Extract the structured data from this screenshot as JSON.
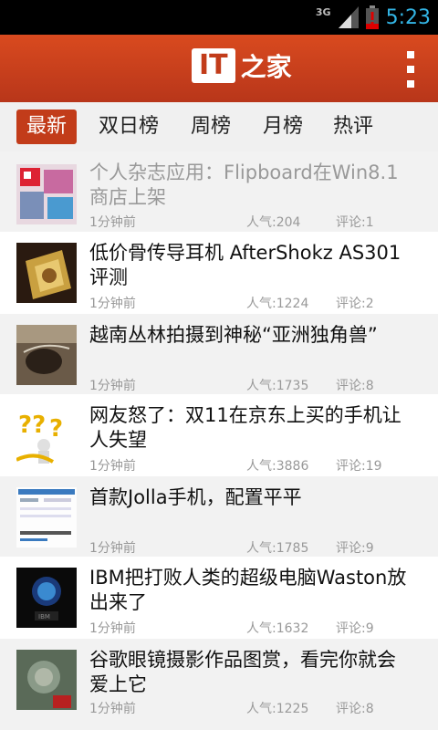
{
  "status": {
    "network": "3G",
    "time": "5:23"
  },
  "app": {
    "logo_it": "IT",
    "logo_text": "之家"
  },
  "tabs": [
    {
      "label": "最新",
      "active": true
    },
    {
      "label": "双日榜",
      "active": false
    },
    {
      "label": "周榜",
      "active": false
    },
    {
      "label": "月榜",
      "active": false
    },
    {
      "label": "热评",
      "active": false
    }
  ],
  "news": [
    {
      "title": "个人杂志应用：Flipboard在Win8.1商店上架",
      "time": "1分钟前",
      "popularity": "人气:204",
      "comments": "评论:1",
      "read": true
    },
    {
      "title": "低价骨传导耳机 AfterShokz AS301评测",
      "time": "1分钟前",
      "popularity": "人气:1224",
      "comments": "评论:2",
      "read": false
    },
    {
      "title": "越南丛林拍摄到神秘“亚洲独角兽”",
      "time": "1分钟前",
      "popularity": "人气:1735",
      "comments": "评论:8",
      "read": false
    },
    {
      "title": "网友怒了：双11在京东上买的手机让人失望",
      "time": "1分钟前",
      "popularity": "人气:3886",
      "comments": "评论:19",
      "read": false
    },
    {
      "title": "首款Jolla手机，配置平平",
      "time": "1分钟前",
      "popularity": "人气:1785",
      "comments": "评论:9",
      "read": false
    },
    {
      "title": "IBM把打败人类的超级电脑Waston放出来了",
      "time": "1分钟前",
      "popularity": "人气:1632",
      "comments": "评论:9",
      "read": false
    },
    {
      "title": "谷歌眼镜摄影作品图赏，看完你就会爱上它",
      "time": "1分钟前",
      "popularity": "人气:1225",
      "comments": "评论:8",
      "read": false
    }
  ]
}
